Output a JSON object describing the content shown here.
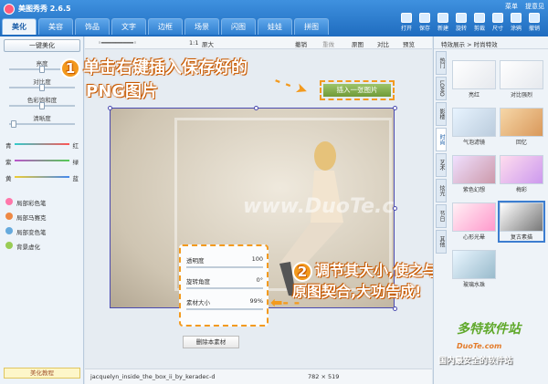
{
  "app": {
    "title": "美图秀秀 2.6.5"
  },
  "tabs": [
    "美化",
    "美容",
    "饰品",
    "文字",
    "边框",
    "场景",
    "闪图",
    "娃娃",
    "拼图"
  ],
  "topright": [
    "菜单",
    "提意见"
  ],
  "toolbar": [
    "打开",
    "保存",
    "新建",
    "旋转",
    "剪裁",
    "尺寸",
    "涂鸦",
    "撤销"
  ],
  "left": {
    "onekey": "一键美化",
    "sliders": [
      "亮度",
      "对比度",
      "色彩饱和度",
      "清晰度"
    ],
    "colors": [
      [
        "青",
        "红"
      ],
      [
        "紫",
        "绿"
      ],
      [
        "黄",
        "蓝"
      ]
    ],
    "brushes": [
      "局部彩色笔",
      "局部马赛克",
      "局部变色笔",
      "背景虚化"
    ],
    "tutorial": "美化教程"
  },
  "canvas_toolbar": {
    "zoom": "1:1",
    "max": "原大",
    "undo": "撤销",
    "redo": "重做",
    "original": "原图",
    "compare": "对比",
    "preview": "预览"
  },
  "callout1": {
    "num": "1",
    "line1": "单击右键插入保存好的",
    "line2": "PNG图片"
  },
  "insert_button": "插入一张图片",
  "watermark": "www.DuoTe.com",
  "material_panel": {
    "rows": [
      {
        "label": "透明度",
        "value": "100"
      },
      {
        "label": "旋转角度",
        "value": "0°"
      },
      {
        "label": "素材大小",
        "value": "99%"
      }
    ],
    "delete": "删除本素材"
  },
  "callout2": {
    "num": "2",
    "line1": "调节其大小,使之与",
    "line2": "原图契合,大功告成!"
  },
  "status": {
    "filename": "jacquelyn_inside_the_box_ii_by_keradec-d",
    "size": "782 × 519"
  },
  "right": {
    "head": "特效展示 > 时尚特效",
    "vtabs": [
      "热门",
      "LOMO",
      "影楼",
      "时尚",
      "艺术",
      "炫光",
      "节日",
      "其他"
    ],
    "thumbs": [
      "亮红",
      "对比强烈",
      "气泡滤镜",
      "回忆",
      "紫色幻想",
      "梅彩",
      "心形光晕",
      "复古素描",
      "玻璃水珠"
    ]
  },
  "site": {
    "logo": "多特软件站",
    "domain": "DuoTe.com",
    "slogan": "国内最安全的软件站"
  }
}
